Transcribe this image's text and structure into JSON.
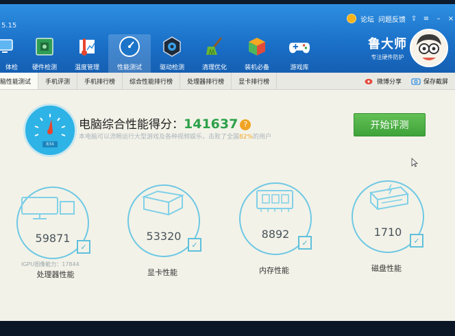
{
  "header": {
    "version": "5.15",
    "top_links": [
      "论坛",
      "问题反馈"
    ],
    "brand_name": "鲁大师",
    "brand_slogan": "专注硬件防护",
    "nav_items": [
      {
        "label": "体检",
        "icon": "monitor-icon"
      },
      {
        "label": "硬件检测",
        "icon": "chip-board-icon"
      },
      {
        "label": "温度管理",
        "icon": "thermometer-icon"
      },
      {
        "label": "性能测试",
        "icon": "speedometer-icon",
        "active": true
      },
      {
        "label": "驱动检测",
        "icon": "gear-hex-icon"
      },
      {
        "label": "清理优化",
        "icon": "broom-icon"
      },
      {
        "label": "装机必备",
        "icon": "cube-icon"
      },
      {
        "label": "游戏库",
        "icon": "gamepad-icon"
      }
    ]
  },
  "tabs": {
    "items": [
      "脑性能测试",
      "手机评测",
      "手机排行榜",
      "综合性能排行榜",
      "处理器排行榜",
      "显卡排行榜"
    ],
    "share_label": "微博分享",
    "save_label": "保存截屏"
  },
  "score": {
    "title": "电脑综合性能得分：",
    "value": "141637",
    "help": "?",
    "desc_prefix": "本电脑可以流畅运行大型游戏及各种视频娱乐，击败了全国",
    "desc_pct": "82%",
    "desc_suffix": "的用户",
    "gauge_label": "834"
  },
  "start_button": "开始评测",
  "components": [
    {
      "name": "处理器性能",
      "value": "59871",
      "sub": "IGPU图像能力：17844",
      "icon": "cpu-monitor-icon"
    },
    {
      "name": "显卡性能",
      "value": "53320",
      "sub": "",
      "icon": "graphics-box-icon"
    },
    {
      "name": "内存性能",
      "value": "8892",
      "sub": "",
      "icon": "memory-chip-icon"
    },
    {
      "name": "磁盘性能",
      "value": "1710",
      "sub": "",
      "icon": "hard-disk-icon"
    }
  ],
  "colors": {
    "header_blue": "#1a6fc7",
    "score_green": "#2da14a",
    "accent_orange": "#f0a423",
    "circle_cyan": "#6ec8e4",
    "button_green": "#3ea33a"
  }
}
